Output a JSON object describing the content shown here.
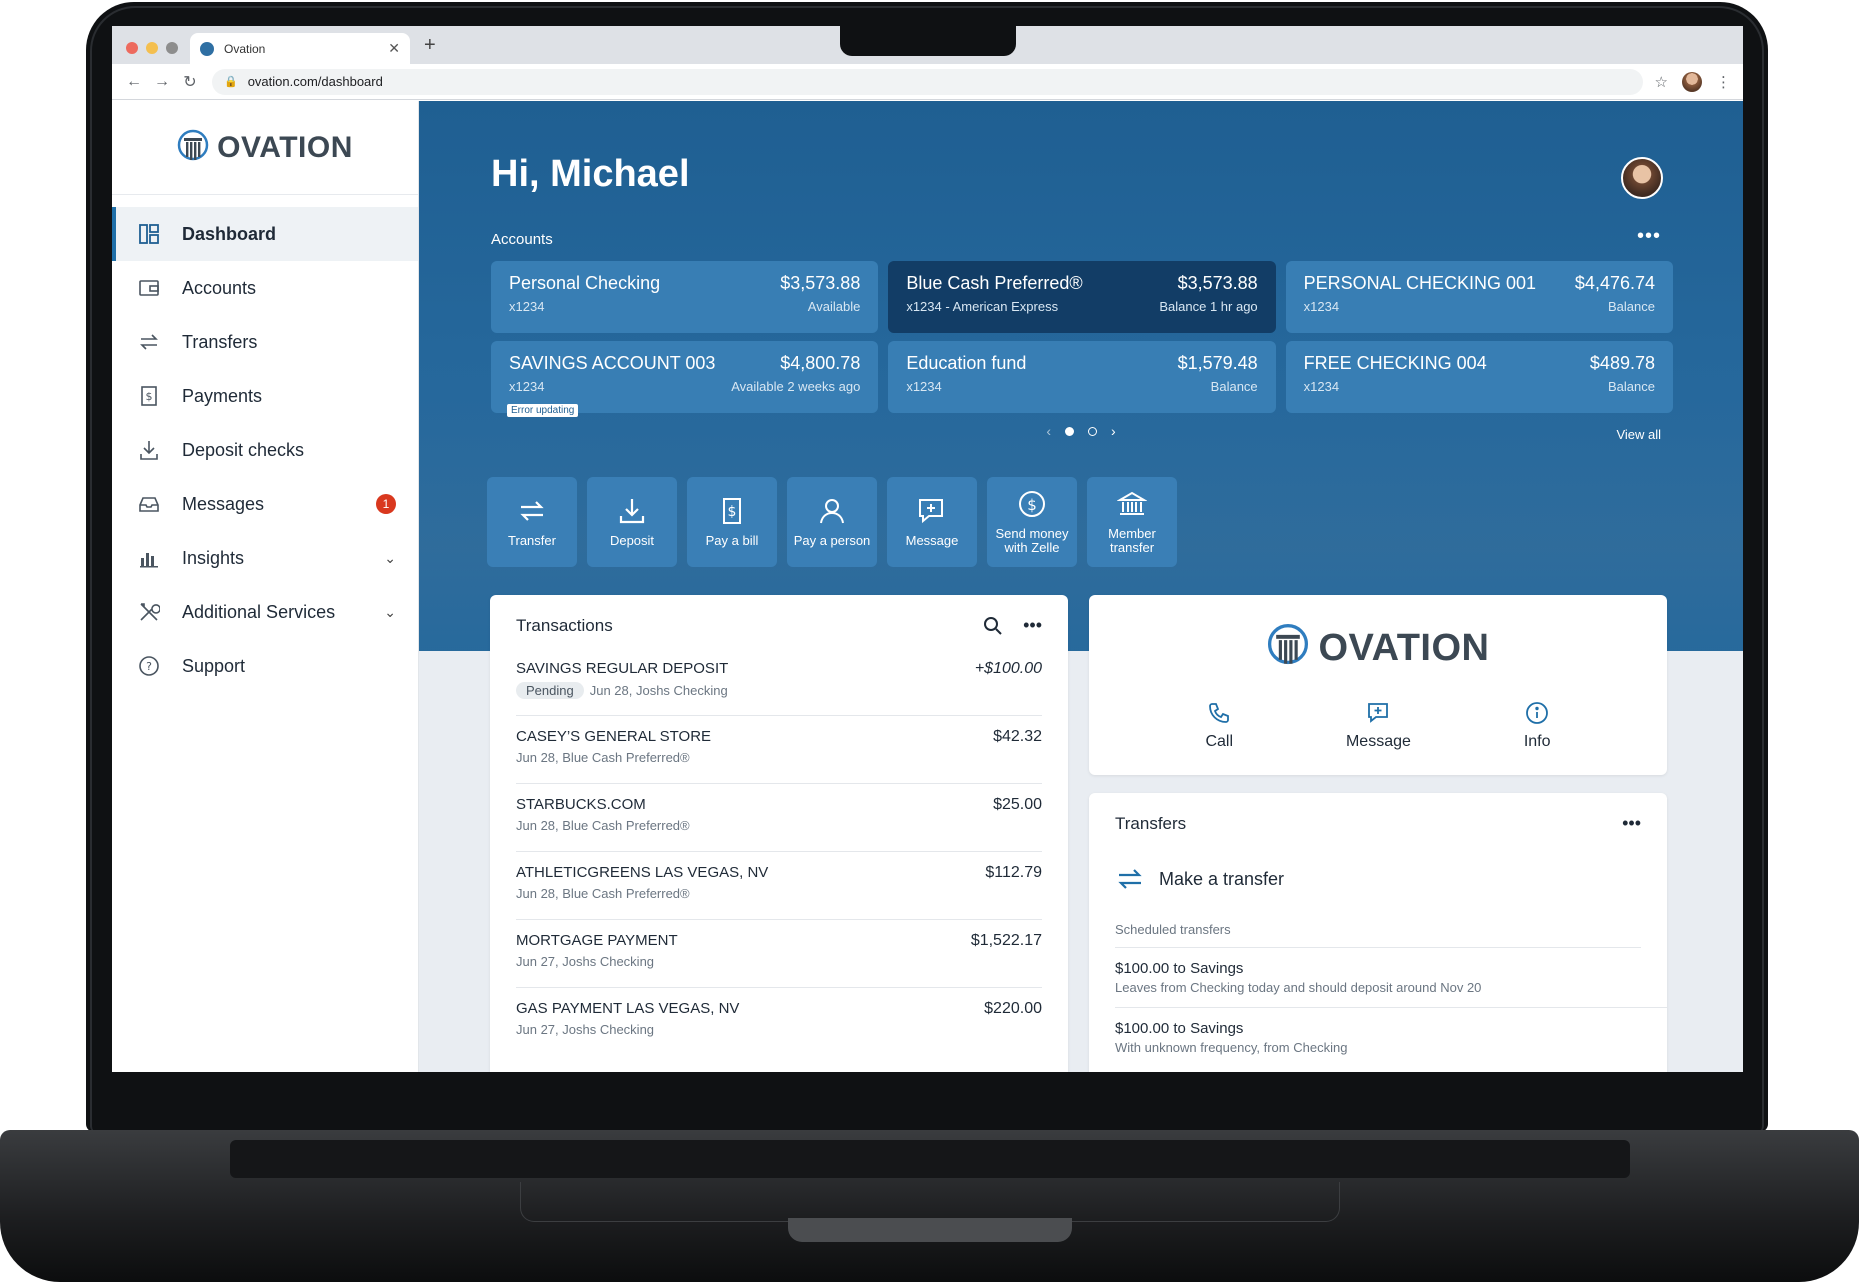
{
  "browser": {
    "tab_title": "Ovation",
    "url": "ovation.com/dashboard"
  },
  "brand": {
    "name": "OVATION"
  },
  "sidebar": {
    "items": [
      {
        "label": "Dashboard",
        "icon": "dashboard-icon",
        "active": true
      },
      {
        "label": "Accounts",
        "icon": "wallet-icon"
      },
      {
        "label": "Transfers",
        "icon": "transfer-icon"
      },
      {
        "label": "Payments",
        "icon": "bill-icon"
      },
      {
        "label": "Deposit checks",
        "icon": "download-icon"
      },
      {
        "label": "Messages",
        "icon": "inbox-icon",
        "badge": "1"
      },
      {
        "label": "Insights",
        "icon": "bar-chart-icon",
        "expandable": true
      },
      {
        "label": "Additional Services",
        "icon": "tools-icon",
        "expandable": true
      },
      {
        "label": "Support",
        "icon": "help-icon"
      }
    ]
  },
  "hero": {
    "greeting": "Hi, Michael",
    "accounts_label": "Accounts",
    "view_all": "View all"
  },
  "accounts": [
    {
      "name": "Personal Checking",
      "number": "x1234",
      "balance": "$3,573.88",
      "balance_note": "Available"
    },
    {
      "name": "Blue Cash Preferred®",
      "number": "x1234 - American Express",
      "balance": "$3,573.88",
      "balance_note": "Balance 1 hr ago"
    },
    {
      "name": "PERSONAL CHECKING 001",
      "number": "x1234",
      "balance": "$4,476.74",
      "balance_note": "Balance"
    },
    {
      "name": "SAVINGS ACCOUNT 003",
      "number": "x1234",
      "balance": "$4,800.78",
      "balance_note": "Available 2 weeks ago",
      "error": "Error updating"
    },
    {
      "name": "Education fund",
      "number": "x1234",
      "balance": "$1,579.48",
      "balance_note": "Balance"
    },
    {
      "name": "FREE CHECKING 004",
      "number": "x1234",
      "balance": "$489.78",
      "balance_note": "Balance"
    }
  ],
  "quick_actions": [
    {
      "label": "Transfer",
      "icon": "transfer-icon"
    },
    {
      "label": "Deposit",
      "icon": "download-icon"
    },
    {
      "label": "Pay a bill",
      "icon": "bill-icon"
    },
    {
      "label": "Pay a person",
      "icon": "person-icon"
    },
    {
      "label": "Message",
      "icon": "message-icon"
    },
    {
      "label": "Send money with Zelle",
      "icon": "dollar-circle-icon"
    },
    {
      "label": "Member transfer",
      "icon": "bank-icon"
    }
  ],
  "transactions": {
    "title": "Transactions",
    "items": [
      {
        "name": "SAVINGS REGULAR DEPOSIT",
        "status": "Pending",
        "detail": "Jun 28, Joshs Checking",
        "amount": "+$100.00"
      },
      {
        "name": "CASEY’S GENERAL STORE",
        "detail": "Jun 28, Blue Cash Preferred®",
        "amount": "$42.32"
      },
      {
        "name": "STARBUCKS.COM",
        "detail": "Jun 28, Blue Cash Preferred®",
        "amount": "$25.00"
      },
      {
        "name": "ATHLETICGREENS LAS VEGAS, NV",
        "detail": "Jun 28, Blue Cash Preferred®",
        "amount": "$112.79"
      },
      {
        "name": "MORTGAGE PAYMENT",
        "detail": "Jun 27, Joshs Checking",
        "amount": "$1,522.17"
      },
      {
        "name": "GAS PAYMENT LAS VEGAS, NV",
        "detail": "Jun 27, Joshs Checking",
        "amount": "$220.00"
      }
    ]
  },
  "contact": {
    "call": "Call",
    "message": "Message",
    "info": "Info"
  },
  "transfers": {
    "title": "Transfers",
    "make_transfer": "Make a transfer",
    "scheduled_label": "Scheduled transfers",
    "scheduled": [
      {
        "title": "$100.00 to Savings",
        "detail": "Leaves from Checking today and should deposit around Nov 20"
      },
      {
        "title": "$100.00 to Savings",
        "detail": "With unknown frequency, from Checking"
      }
    ]
  },
  "colors": {
    "primary": "#1f5f92",
    "selected_account": "#123d66",
    "badge": "#d9381e"
  }
}
